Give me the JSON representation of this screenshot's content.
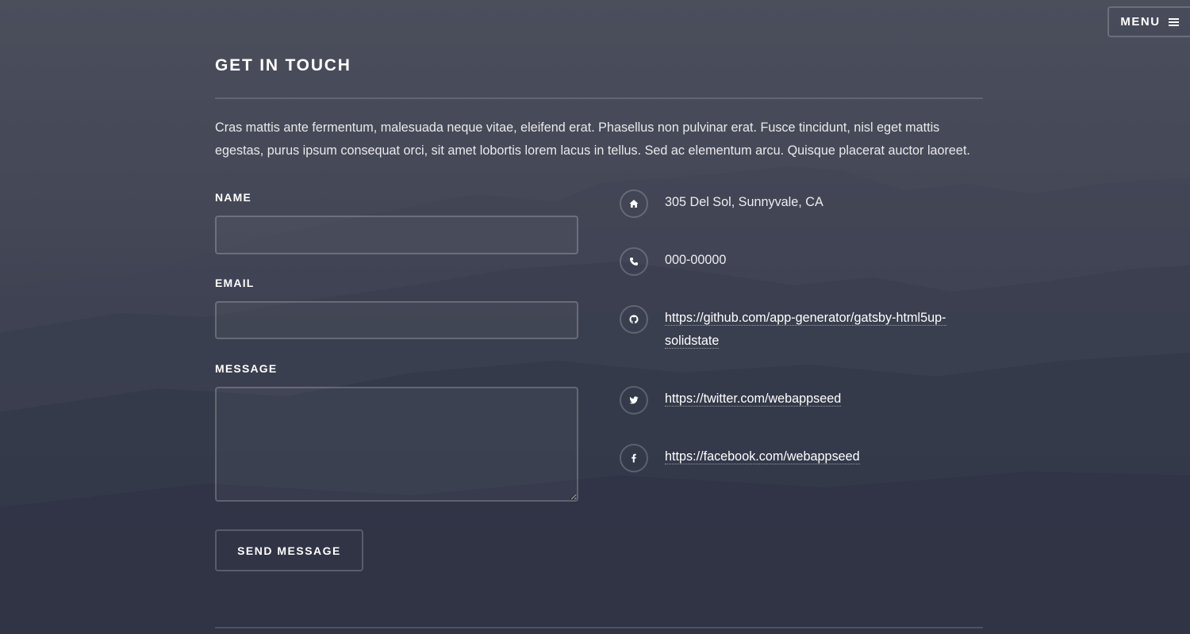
{
  "menu": {
    "label": "MENU",
    "icon": "hamburger-icon"
  },
  "section": {
    "title": "GET IN TOUCH",
    "intro": "Cras mattis ante fermentum, malesuada neque vitae, eleifend erat. Phasellus non pulvinar erat. Fusce tincidunt, nisl eget mattis egestas, purus ipsum consequat orci, sit amet lobortis lorem lacus in tellus. Sed ac elementum arcu. Quisque placerat auctor laoreet."
  },
  "form": {
    "name_label": "NAME",
    "name_value": "",
    "email_label": "EMAIL",
    "email_value": "",
    "message_label": "MESSAGE",
    "message_value": "",
    "submit_label": "SEND MESSAGE"
  },
  "contact": {
    "address": {
      "icon": "home-icon",
      "text": "305 Del Sol, Sunnyvale, CA"
    },
    "phone": {
      "icon": "phone-icon",
      "text": "000-00000"
    },
    "github": {
      "icon": "github-icon",
      "text": "https://github.com/app-generator/gatsby-html5up-solidstate"
    },
    "twitter": {
      "icon": "twitter-icon",
      "text": "https://twitter.com/webappseed"
    },
    "facebook": {
      "icon": "facebook-icon",
      "text": "https://facebook.com/webappseed"
    }
  },
  "colors": {
    "background_top": "#4b4f5c",
    "background_bottom": "#2d3142",
    "text": "#ffffff"
  }
}
